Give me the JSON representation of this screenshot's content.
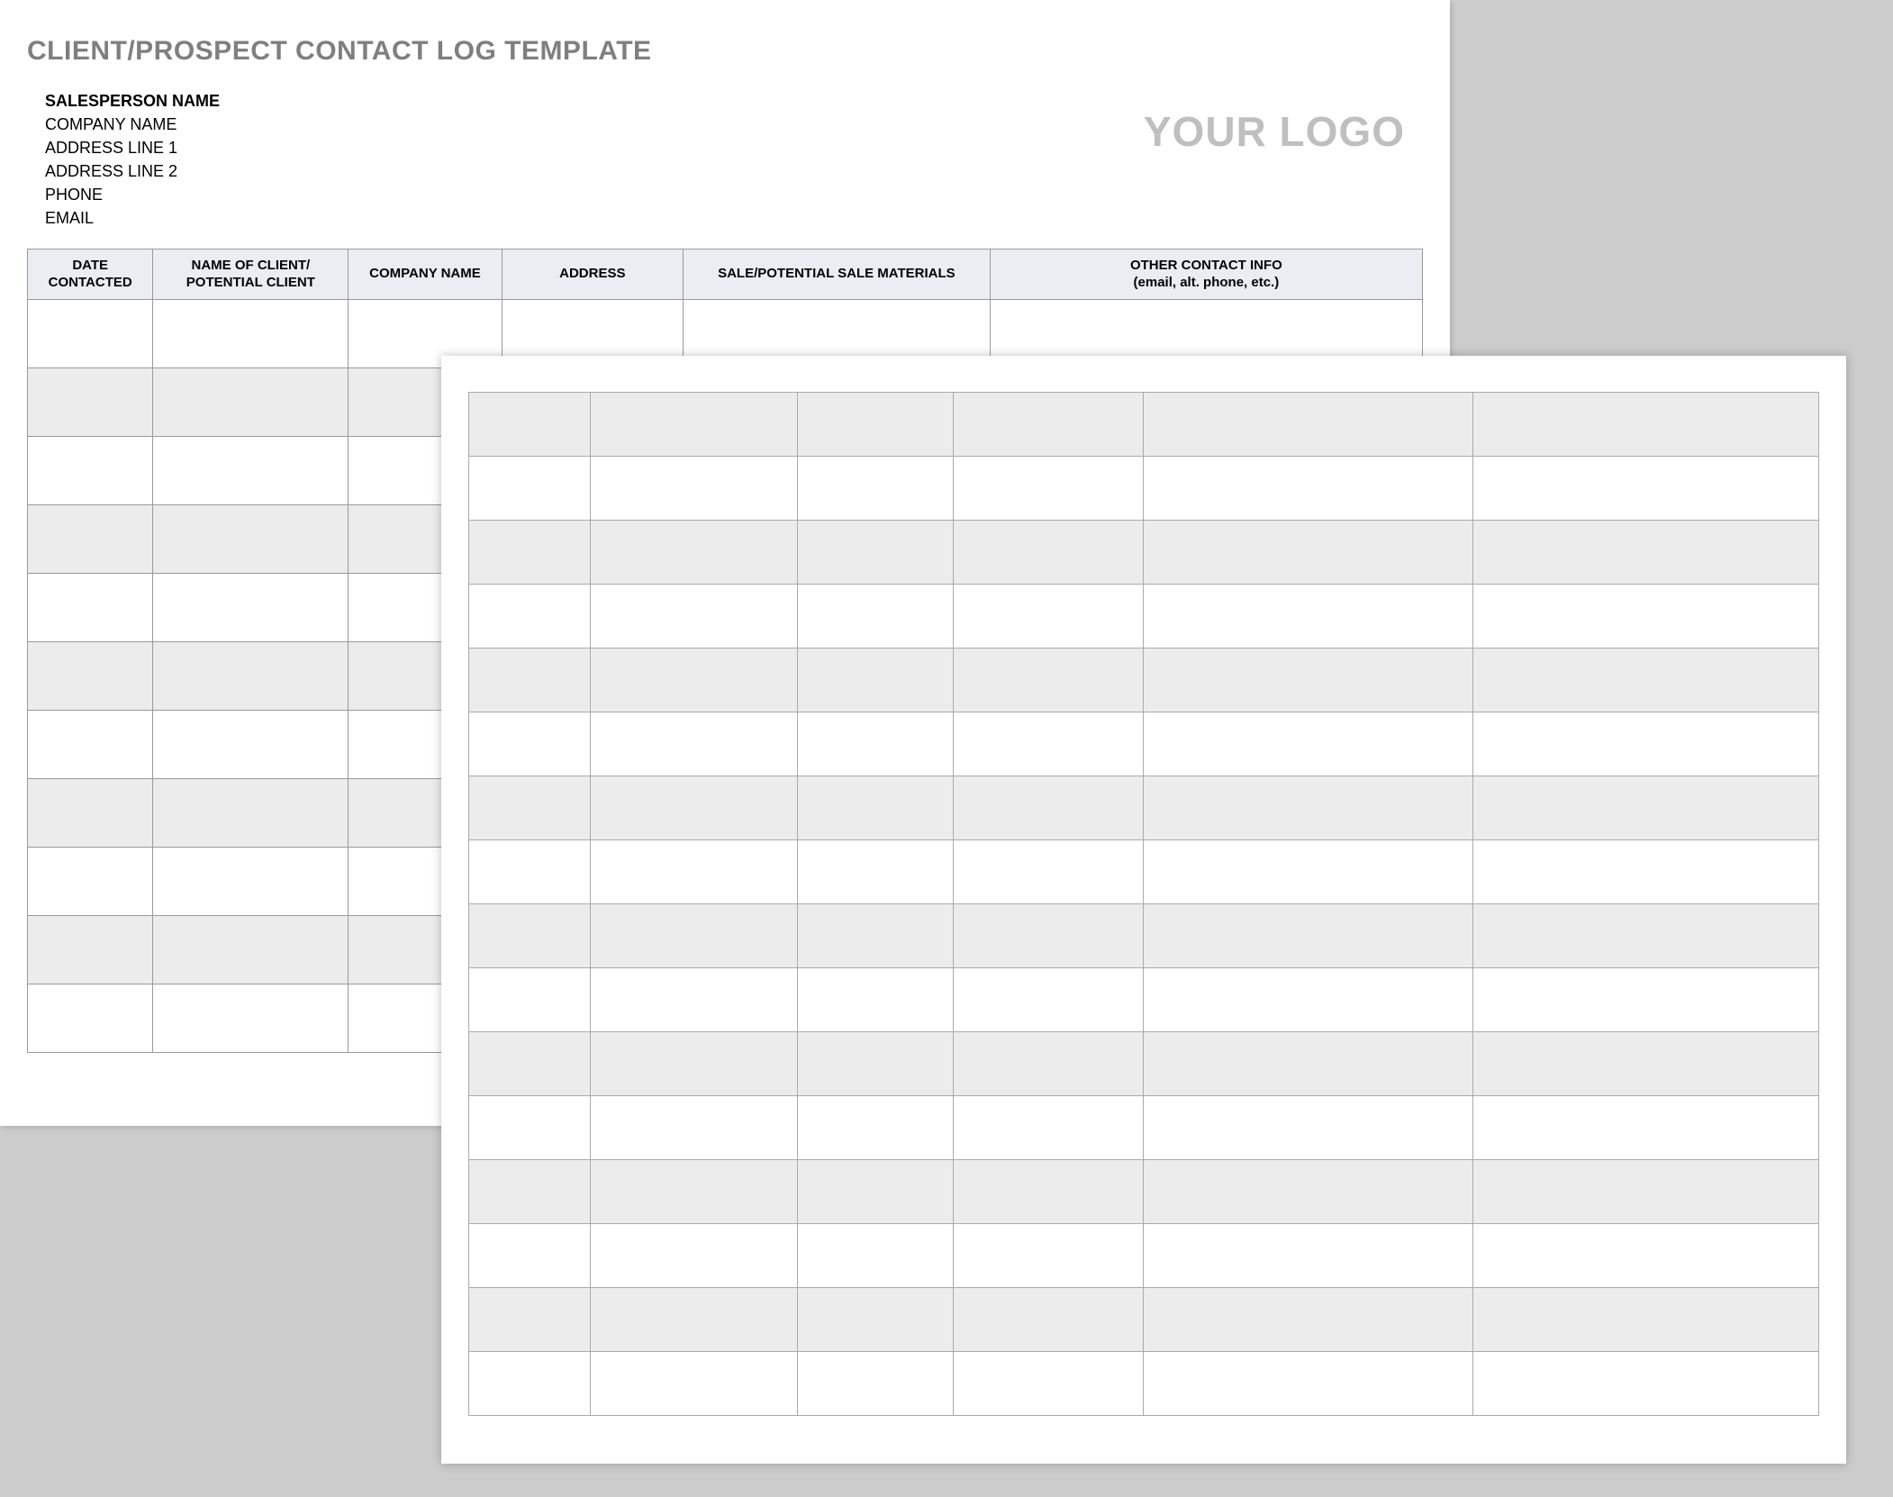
{
  "title": "CLIENT/PROSPECT CONTACT LOG TEMPLATE",
  "salesperson": {
    "name_label": "SALESPERSON NAME",
    "company": "COMPANY NAME",
    "address1": "ADDRESS LINE 1",
    "address2": "ADDRESS LINE 2",
    "phone": "PHONE",
    "email": "EMAIL"
  },
  "logo_placeholder": "YOUR LOGO",
  "table_headers": {
    "date": "DATE CONTACTED",
    "client": "NAME OF CLIENT/ POTENTIAL CLIENT",
    "company": "COMPANY NAME",
    "address": "ADDRESS",
    "sale": "SALE/POTENTIAL SALE MATERIALS",
    "other_line1": "OTHER CONTACT INFO",
    "other_line2": "(email, alt. phone, etc.)"
  }
}
